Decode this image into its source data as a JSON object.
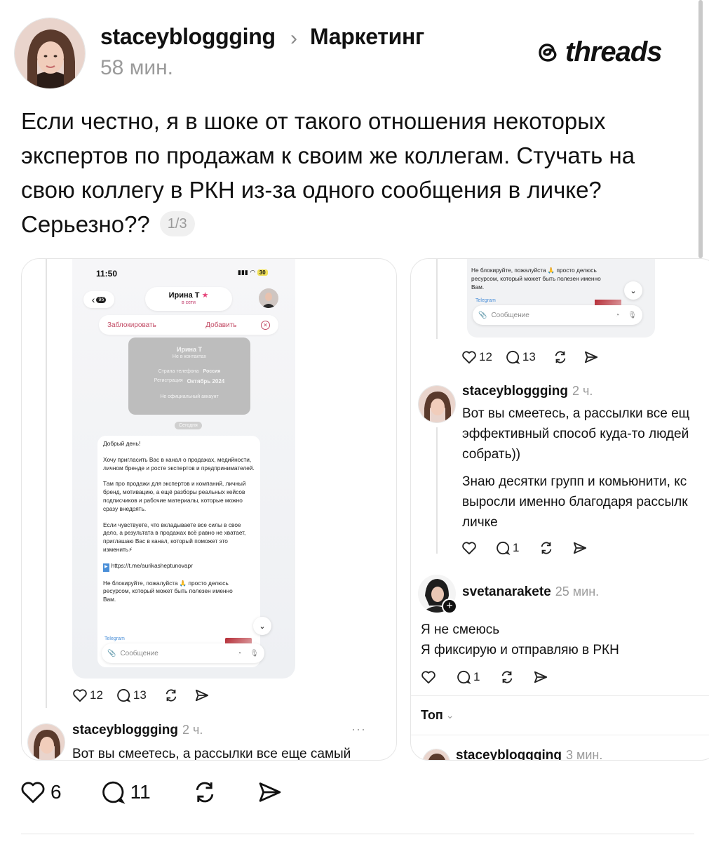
{
  "post": {
    "author": "staceybloggging",
    "topic": "Маркетинг",
    "time": "58 мин.",
    "logo_text": "threads",
    "text": "Если честно, я в шоке от такого отношения некоторых экспертов по продажам к своим же коллегам. Стучать на свою коллегу в РКН из-за одного сообщения в личке? Серьезно??",
    "pager": "1/3",
    "likes": "6",
    "replies": "11"
  },
  "card_left": {
    "phone": {
      "time": "11:50",
      "battery": "30",
      "back_count": "95",
      "contact_name": "Ирина Т",
      "contact_status": "в сети",
      "block_label": "Заблокировать",
      "add_label": "Добавить",
      "info_name": "Ирина Т",
      "info_sub": "Не в контактах",
      "info_phone_label": "Страна телефона",
      "info_phone_value": "Россия",
      "info_reg_label": "Регистрация",
      "info_reg_value": "Октябрь 2024",
      "info_official": "Не официальный аккаунт",
      "today": "Сегодня",
      "msg": {
        "p1": "Добрый день!",
        "p2": "Хочу пригласить Вас в канал о продажах, медийности, личном бренде и росте экспертов и предпринимателей.",
        "p3": "Там про продажи для экспертов и компаний, личный бренд, мотивацию, а ещё разборы реальных кейсов подписчиков и рабочие материалы, которые можно сразу внедрять.",
        "p4": "Если чувствуете, что вкладываете все силы в свое дело, а результата в продажах всё равно не хватает, приглашаю Вас в канал, который поможет это изменить⚡",
        "link": "https://t.me/aurikasheptunovapr",
        "p5": "Не блокируйте, пожалуйста 🙏 просто делюсь ресурсом, который может быть полезен именно Вам."
      },
      "tg_label": "Telegram",
      "input_placeholder": "Сообщение"
    },
    "likes": "12",
    "replies": "13",
    "reply": {
      "author": "staceybloggging",
      "time": "2 ч.",
      "more": "···",
      "text": "Вот вы смеетесь, а рассылки все еще самый"
    }
  },
  "card_right": {
    "phone": {
      "msg": "Не блокируйте, пожалуйста 🙏 просто делюсь ресурсом, который может быть полезен именно Вам.",
      "tg_label": "Telegram",
      "input_placeholder": "Сообщение"
    },
    "likes": "12",
    "replies": "13",
    "reply1": {
      "author": "staceybloggging",
      "time": "2 ч.",
      "line1": "Вот вы смеетесь, а рассылки все ещ",
      "line2": "эффективный способ куда-то людей",
      "line3": "собрать))",
      "line4": "Знаю десятки групп и комьюнити, кс",
      "line5": "выросли именно благодаря рассылк",
      "line6": "личке",
      "likes": "",
      "replies": "1"
    },
    "reply2": {
      "author": "svetanarakete",
      "time": "25 мин.",
      "line1": "Я не смеюсь",
      "line2": "Я фиксирую и отправляю в РКН",
      "replies": "1"
    },
    "sort_label": "Топ",
    "reply3": {
      "author": "staceybloggging",
      "time": "3 мин."
    }
  }
}
